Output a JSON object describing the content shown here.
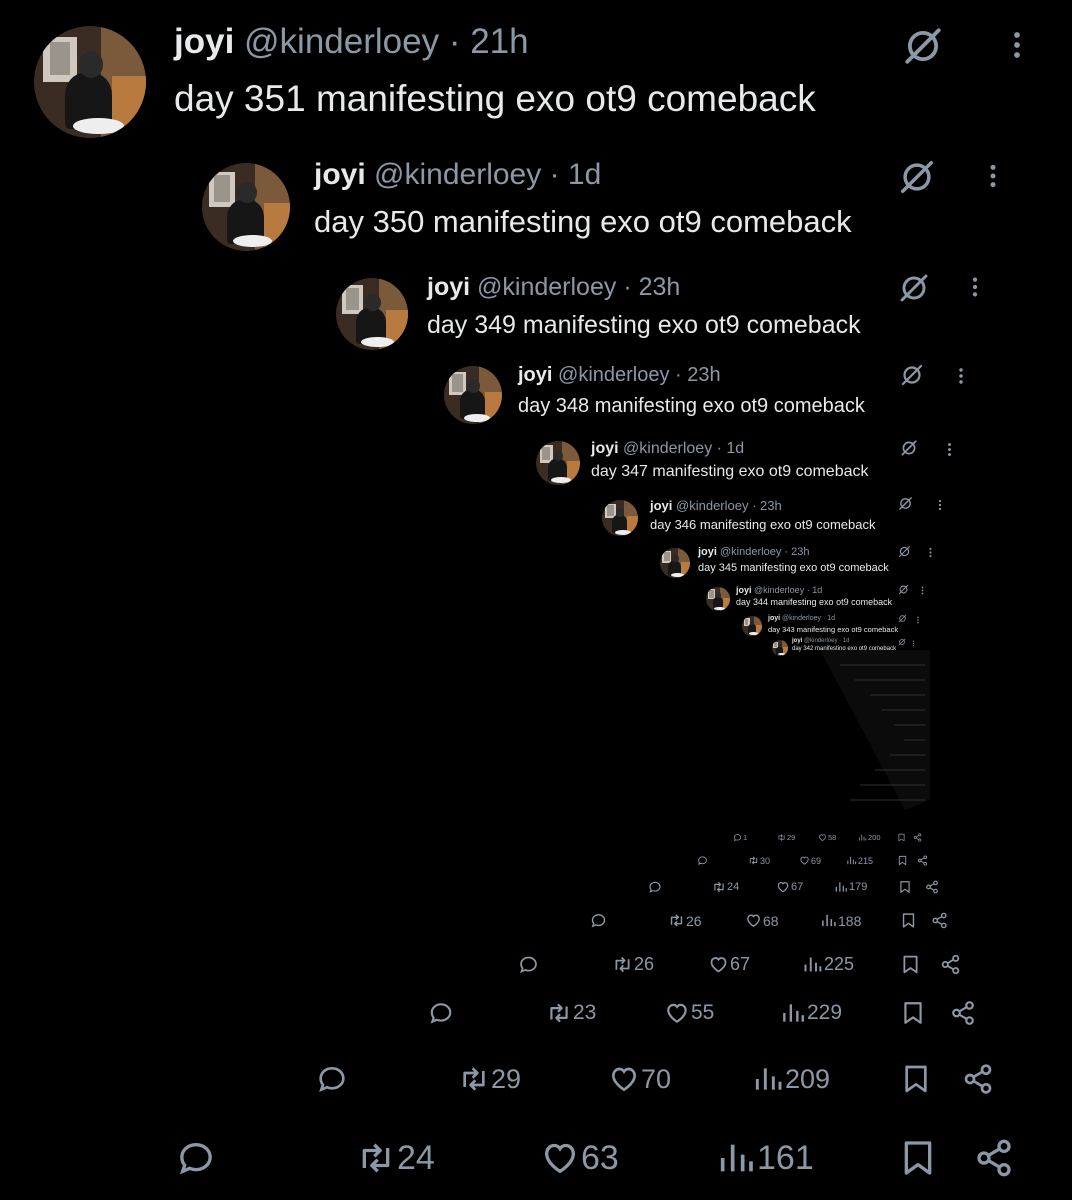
{
  "tweets": [
    {
      "name": "joyi",
      "handle": "@kinderloey",
      "sep": " · ",
      "time": "21h",
      "text": "day 351 manifesting exo ot9 comeback"
    },
    {
      "name": "joyi",
      "handle": "@kinderloey",
      "sep": " · ",
      "time": "1d",
      "text": "day 350 manifesting exo ot9 comeback"
    },
    {
      "name": "joyi",
      "handle": "@kinderloey",
      "sep": " · ",
      "time": "23h",
      "text": "day 349 manifesting exo ot9 comeback"
    },
    {
      "name": "joyi",
      "handle": "@kinderloey",
      "sep": " · ",
      "time": "23h",
      "text": "day 348 manifesting exo ot9 comeback"
    },
    {
      "name": "joyi",
      "handle": "@kinderloey",
      "sep": " · ",
      "time": "1d",
      "text": "day 347 manifesting exo ot9 comeback"
    },
    {
      "name": "joyi",
      "handle": "@kinderloey",
      "sep": " · ",
      "time": "23h",
      "text": "day 346 manifesting exo ot9 comeback"
    },
    {
      "name": "joyi",
      "handle": "@kinderloey",
      "sep": " · ",
      "time": "23h",
      "text": "day 345 manifesting exo ot9 comeback"
    },
    {
      "name": "joyi",
      "handle": "@kinderloey",
      "sep": " · ",
      "time": "1d",
      "text": "day 344 manifesting exo ot9 comeback"
    },
    {
      "name": "joyi",
      "handle": "@kinderloey",
      "sep": " · ",
      "time": "1d",
      "text": "day 343 manifesting exo ot9 comeback"
    },
    {
      "name": "joyi",
      "handle": "@kinderloey",
      "sep": " · ",
      "time": "1d",
      "text": "day 342 manifesting exo ot9 comeback"
    }
  ],
  "actions": [
    {
      "replies": "",
      "reposts": "24",
      "likes": "63",
      "views": "161"
    },
    {
      "replies": "",
      "reposts": "29",
      "likes": "70",
      "views": "209"
    },
    {
      "replies": "",
      "reposts": "23",
      "likes": "55",
      "views": "229"
    },
    {
      "replies": "",
      "reposts": "26",
      "likes": "67",
      "views": "225"
    },
    {
      "replies": "",
      "reposts": "26",
      "likes": "68",
      "views": "188"
    },
    {
      "replies": "",
      "reposts": "24",
      "likes": "67",
      "views": "179"
    },
    {
      "replies": "",
      "reposts": "30",
      "likes": "69",
      "views": "215"
    },
    {
      "replies": "1",
      "reposts": "29",
      "likes": "58",
      "views": "200"
    }
  ],
  "colors": {
    "bg": "#000000",
    "text": "#e7e9ea",
    "muted": "#8b98a5"
  },
  "icons": {
    "grok": "grok-icon",
    "more": "more-icon",
    "reply": "reply-icon",
    "repost": "repost-icon",
    "like": "like-icon",
    "views": "views-icon",
    "bookmark": "bookmark-icon",
    "share": "share-icon"
  }
}
